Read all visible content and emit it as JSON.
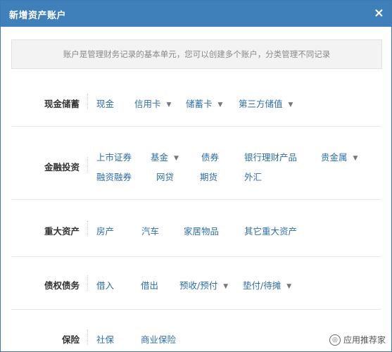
{
  "dialog": {
    "title": "新增资产账户",
    "close_label": "×"
  },
  "notice": "账户是管理财务记录的基本单元，您可以创建多个账户，分类管理不同记录",
  "sections": [
    {
      "label": "现金储蓄",
      "items": [
        {
          "label": "现金",
          "dropdown": false
        },
        {
          "label": "信用卡",
          "dropdown": true
        },
        {
          "label": "储蓄卡",
          "dropdown": true
        },
        {
          "label": "第三方储值",
          "dropdown": true
        }
      ]
    },
    {
      "label": "金融投资",
      "items": [
        {
          "label": "上市证券",
          "dropdown": false
        },
        {
          "label": "基金",
          "dropdown": true
        },
        {
          "label": "债券",
          "dropdown": false
        },
        {
          "label": "银行理财产品",
          "dropdown": false
        },
        {
          "label": "贵金属",
          "dropdown": true
        },
        {
          "label": "融资融券",
          "dropdown": false
        },
        {
          "label": "网贷",
          "dropdown": false
        },
        {
          "label": "期货",
          "dropdown": false
        },
        {
          "label": "外汇",
          "dropdown": false
        }
      ]
    },
    {
      "label": "重大资产",
      "items": [
        {
          "label": "房产",
          "dropdown": false
        },
        {
          "label": "汽车",
          "dropdown": false
        },
        {
          "label": "家居物品",
          "dropdown": false
        },
        {
          "label": "其它重大资产",
          "dropdown": false
        }
      ]
    },
    {
      "label": "债权债务",
      "items": [
        {
          "label": "借入",
          "dropdown": false
        },
        {
          "label": "借出",
          "dropdown": false
        },
        {
          "label": "预收/预付",
          "dropdown": true
        },
        {
          "label": "垫付/待摊",
          "dropdown": true
        }
      ]
    },
    {
      "label": "保险",
      "items": [
        {
          "label": "社保",
          "dropdown": false
        },
        {
          "label": "商业保险",
          "dropdown": false
        }
      ]
    }
  ],
  "watermark": "应用推荐家",
  "caret_glyph": "▼"
}
